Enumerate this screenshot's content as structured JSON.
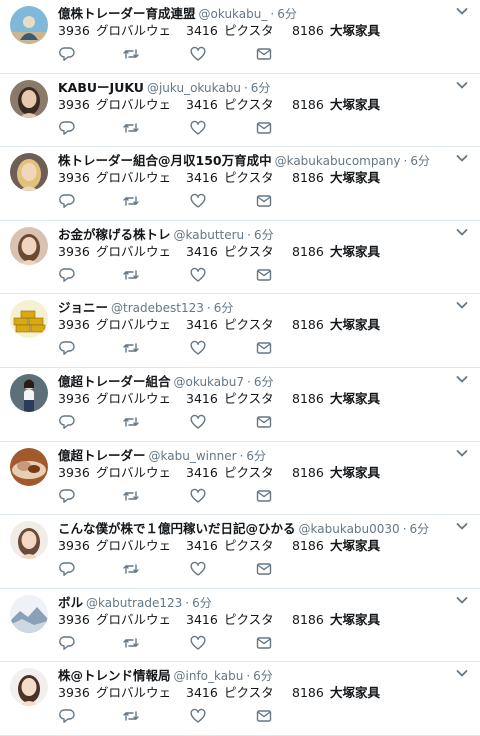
{
  "retweets": [],
  "tweets": [
    {
      "name": "億株トレーダー育成連盟",
      "handle": "@okukabu_",
      "time": "6分",
      "avatar": "sky-person-avatar",
      "palette": [
        "#7fb8d8",
        "#eadbc6",
        "#3a5b78"
      ]
    },
    {
      "name": "KABUーJUKU",
      "handle": "@juku_okukabu",
      "time": "6分",
      "avatar": "woman-portrait-avatar",
      "palette": [
        "#8a7a6a",
        "#e7c9b0",
        "#3b2a20"
      ]
    },
    {
      "name": "株トレーダー組合@月収150万育成中",
      "handle": "@kabukabucompany",
      "time": "6分",
      "avatar": "blonde-woman-avatar",
      "palette": [
        "#6e5e58",
        "#f1d6bc",
        "#e2c27a"
      ]
    },
    {
      "name": "お金が稼げる株トレ",
      "handle": "@kabutteru",
      "time": "6分",
      "avatar": "woman-portrait-avatar",
      "palette": [
        "#d9c2b1",
        "#f0d4bf",
        "#6b4a33"
      ]
    },
    {
      "name": "ジョニー",
      "handle": "@tradebest123",
      "time": "6分",
      "avatar": "gold-bars-avatar",
      "palette": [
        "#f5f0d0",
        "#d9a914",
        "#8a6a05"
      ]
    },
    {
      "name": "億超トレーダー組合",
      "handle": "@okukabu7",
      "time": "6分",
      "avatar": "standing-woman-avatar",
      "palette": [
        "#5d6f78",
        "#e9d2c0",
        "#2c3b5a"
      ]
    },
    {
      "name": "億超トレーダー",
      "handle": "@kabu_winner",
      "time": "6分",
      "avatar": "food-avatar",
      "palette": [
        "#c59b7c",
        "#a25a2c",
        "#e6cfb4"
      ]
    },
    {
      "name": "こんな僕が株で１億円稼いだ日記@ひかる",
      "handle": "@kabukabu0030",
      "time": "6分",
      "avatar": "woman-portrait-avatar",
      "palette": [
        "#f2ece6",
        "#f3d8c6",
        "#6a4a38"
      ]
    },
    {
      "name": "ボル",
      "handle": "@kabutrade123",
      "time": "6分",
      "avatar": "landscape-avatar",
      "palette": [
        "#cfd8e2",
        "#eef2f6",
        "#8aa0b8"
      ]
    },
    {
      "name": "株@トレンド情報局",
      "handle": "@info_kabu",
      "time": "6分",
      "avatar": "woman-portrait-avatar",
      "palette": [
        "#f3efec",
        "#f4dccb",
        "#4b3226"
      ]
    }
  ],
  "body_text": {
    "t1": "3936",
    "t2": "グロバルウェ",
    "t3": "3416",
    "t4": "ピクスタ",
    "t5": "8186",
    "t6": "大塚家具"
  },
  "separator": "·",
  "colors": {
    "text": "#14171a",
    "muted": "#657786",
    "border": "#e1e8ed",
    "icon": "#657786"
  }
}
